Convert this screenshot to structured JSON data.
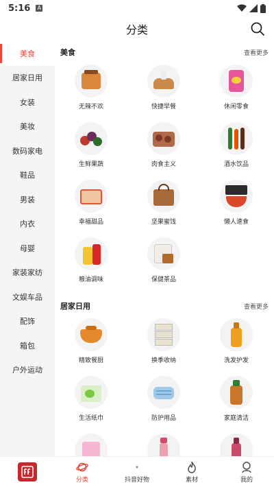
{
  "status_bar": {
    "time": "5:16",
    "badge": "A"
  },
  "header": {
    "title": "分类"
  },
  "sidebar": {
    "items": [
      {
        "label": "美食"
      },
      {
        "label": "居家日用"
      },
      {
        "label": "女装"
      },
      {
        "label": "美妆"
      },
      {
        "label": "数码家电"
      },
      {
        "label": "鞋品"
      },
      {
        "label": "男装"
      },
      {
        "label": "内衣"
      },
      {
        "label": "母婴"
      },
      {
        "label": "家装家纺"
      },
      {
        "label": "文娱车品"
      },
      {
        "label": "配饰"
      },
      {
        "label": "箱包"
      },
      {
        "label": "户外运动"
      }
    ]
  },
  "sections": [
    {
      "title": "美食",
      "more": "查看更多",
      "items": [
        {
          "label": "无辣不欢"
        },
        {
          "label": "快捷早餐"
        },
        {
          "label": "休闲零食"
        },
        {
          "label": "生鲜果蔬"
        },
        {
          "label": "肉食主义"
        },
        {
          "label": "酒水饮品"
        },
        {
          "label": "幸福甜品"
        },
        {
          "label": "坚果蜜饯"
        },
        {
          "label": "懒人速食"
        },
        {
          "label": "粮油调味"
        },
        {
          "label": "保健茶品"
        }
      ]
    },
    {
      "title": "居家日用",
      "more": "查看更多",
      "items": [
        {
          "label": "精致餐厨"
        },
        {
          "label": "换季收纳"
        },
        {
          "label": "洗发护发"
        },
        {
          "label": "生活纸巾"
        },
        {
          "label": "防护用品"
        },
        {
          "label": "家庭清洁"
        },
        {
          "label": ""
        },
        {
          "label": ""
        },
        {
          "label": ""
        }
      ]
    }
  ],
  "bottom_nav": {
    "items": [
      {
        "label": "分类",
        "icon": "planet-icon"
      },
      {
        "label": "抖音好物",
        "icon": "dot-icon"
      },
      {
        "label": "素材",
        "icon": "flame-icon"
      },
      {
        "label": "我的",
        "icon": "user-icon"
      }
    ]
  },
  "colors": {
    "accent": "#e8453c",
    "sidebar_bg": "#f5f5f5",
    "logo": "#c8292e"
  }
}
